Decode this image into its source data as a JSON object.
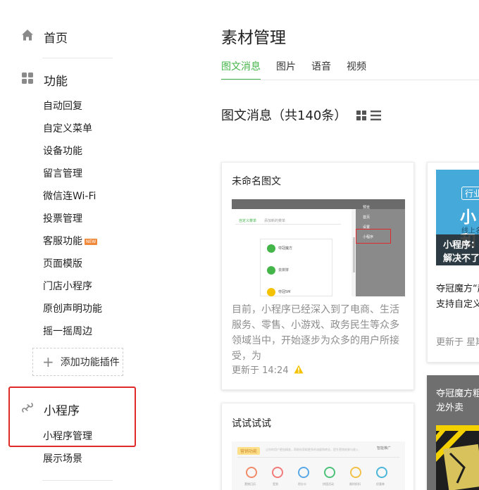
{
  "sidebar": {
    "home_label": "首页",
    "functions_label": "功能",
    "function_items": [
      "自动回复",
      "自定义菜单",
      "设备功能",
      "留言管理",
      "微信连Wi-Fi",
      "投票管理",
      "客服功能",
      "页面模版",
      "门店小程序",
      "原创声明功能",
      "摇一摇周边"
    ],
    "new_badge": "NEW",
    "add_plugin_label": "添加功能插件",
    "miniprogram_label": "小程序",
    "miniprogram_items": [
      "小程序管理",
      "展示场景"
    ]
  },
  "main": {
    "page_title": "素材管理",
    "tabs": [
      {
        "label": "图文消息",
        "active": true
      },
      {
        "label": "图片",
        "active": false
      },
      {
        "label": "语音",
        "active": false
      },
      {
        "label": "视频",
        "active": false
      }
    ],
    "list_title": "图文消息（共140条）",
    "cards": [
      {
        "title": "未命名图文",
        "digest": "目前，小程序已经深入到了电商、生活服务、零售、小游戏、政务民生等众多领域当中，开始逐步为众多的用户所接受，为",
        "updated": "更新于 14:24"
      },
      {
        "title": "试试试试"
      }
    ],
    "right_card": {
      "banner_tag": "行业",
      "banner_big": "小和",
      "banner_sub": "线上名",
      "banner_caption_1": "小程序：",
      "banner_caption_2": "解决不了",
      "text_1": "夺冠魔方“超",
      "text_2": "支持自定义",
      "updated": "更新于 星期"
    },
    "right_card_2": {
      "text_1": "夺冠魔方粗",
      "text_2": "龙外卖"
    },
    "thumb1": {
      "header_label": "自定义菜单",
      "header_label_2": "添加新的菜单",
      "rows": [
        "夺冠魔方",
        "去拼拼",
        "夺冠5M"
      ],
      "side_items": [
        "预览",
        "首页",
        "设置",
        "小程序"
      ]
    },
    "thumb2": {
      "tag": "营销功能",
      "logo_text": "智能推广",
      "desc": "让你的用户更加精准，帮助你获取更多的流量和转化，提升营销效果与收入",
      "icon_labels": [
        "营销日历",
        "签到",
        "积分卡",
        "拼团活动",
        "限时折扣",
        "优惠券"
      ]
    }
  },
  "colors": {
    "accent_green": "#44b549",
    "highlight_red": "#e02a2a",
    "banner_blue": "#45a9d9",
    "warn_yellow": "#f4c200"
  }
}
